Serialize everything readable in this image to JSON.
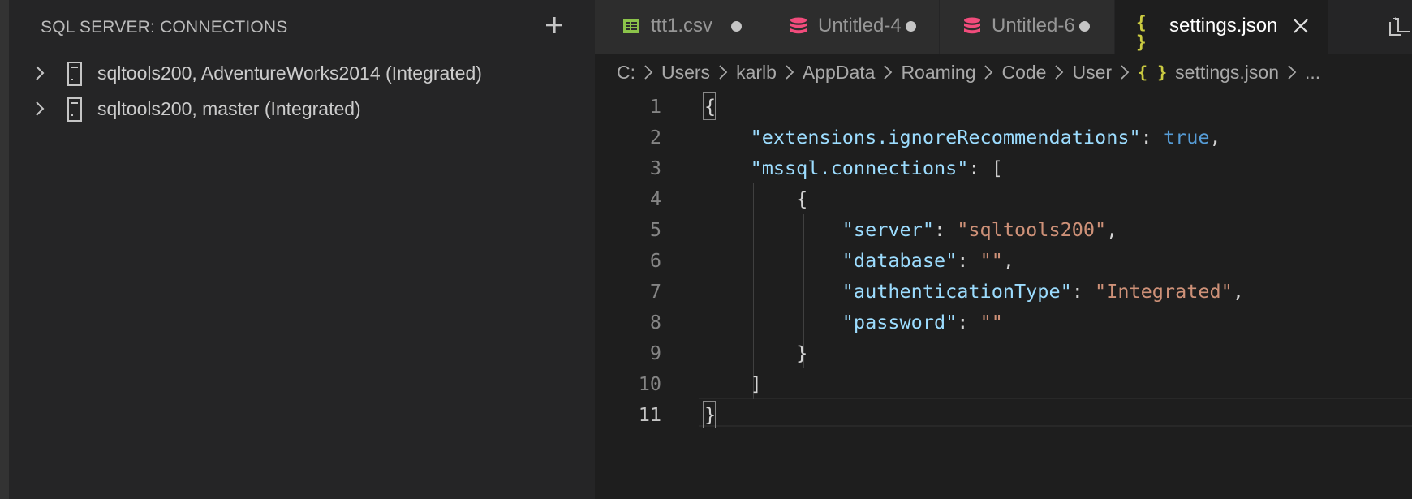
{
  "sidebar": {
    "title": "SQL SERVER: CONNECTIONS",
    "add_icon": "plus-icon",
    "connections": [
      {
        "label": "sqltools200, AdventureWorks2014 (Integrated)",
        "icon": "server-icon"
      },
      {
        "label": "sqltools200, master (Integrated)",
        "icon": "server-icon"
      }
    ]
  },
  "tabs": [
    {
      "label": "ttt1.csv",
      "icon": "csv-table-icon",
      "dirty": true,
      "active": false
    },
    {
      "label": "Untitled-4",
      "icon": "database-icon",
      "dirty": true,
      "active": false
    },
    {
      "label": "Untitled-6",
      "icon": "database-icon",
      "dirty": true,
      "active": false
    },
    {
      "label": "settings.json",
      "icon": "json-braces-icon",
      "dirty": false,
      "active": true
    }
  ],
  "tab_icon_glyph": "{ }",
  "breadcrumb": {
    "parts": [
      "C:",
      "Users",
      "karlb",
      "AppData",
      "Roaming",
      "Code",
      "User"
    ],
    "file_icon": "{ }",
    "file": "settings.json",
    "more": "..."
  },
  "code": {
    "line_numbers": [
      "1",
      "2",
      "3",
      "4",
      "5",
      "6",
      "7",
      "8",
      "9",
      "10",
      "11"
    ],
    "current_line": "11",
    "lines": [
      "{",
      "    \"extensions.ignoreRecommendations\": true,",
      "    \"mssql.connections\": [",
      "        {",
      "            \"server\": \"sqltools200\",",
      "            \"database\": \"\",",
      "            \"authenticationType\": \"Integrated\",",
      "            \"password\": \"\"",
      "        }",
      "    ]",
      "}"
    ]
  },
  "colors": {
    "sidebar_bg": "#252526",
    "editor_bg": "#1e1e1e",
    "json_key": "#9cdcfe",
    "json_string": "#ce9178",
    "json_boolean": "#569cd6",
    "csv_icon": "#8bc34a",
    "db_icon": "#f14c7c",
    "json_icon": "#cbcb41"
  }
}
